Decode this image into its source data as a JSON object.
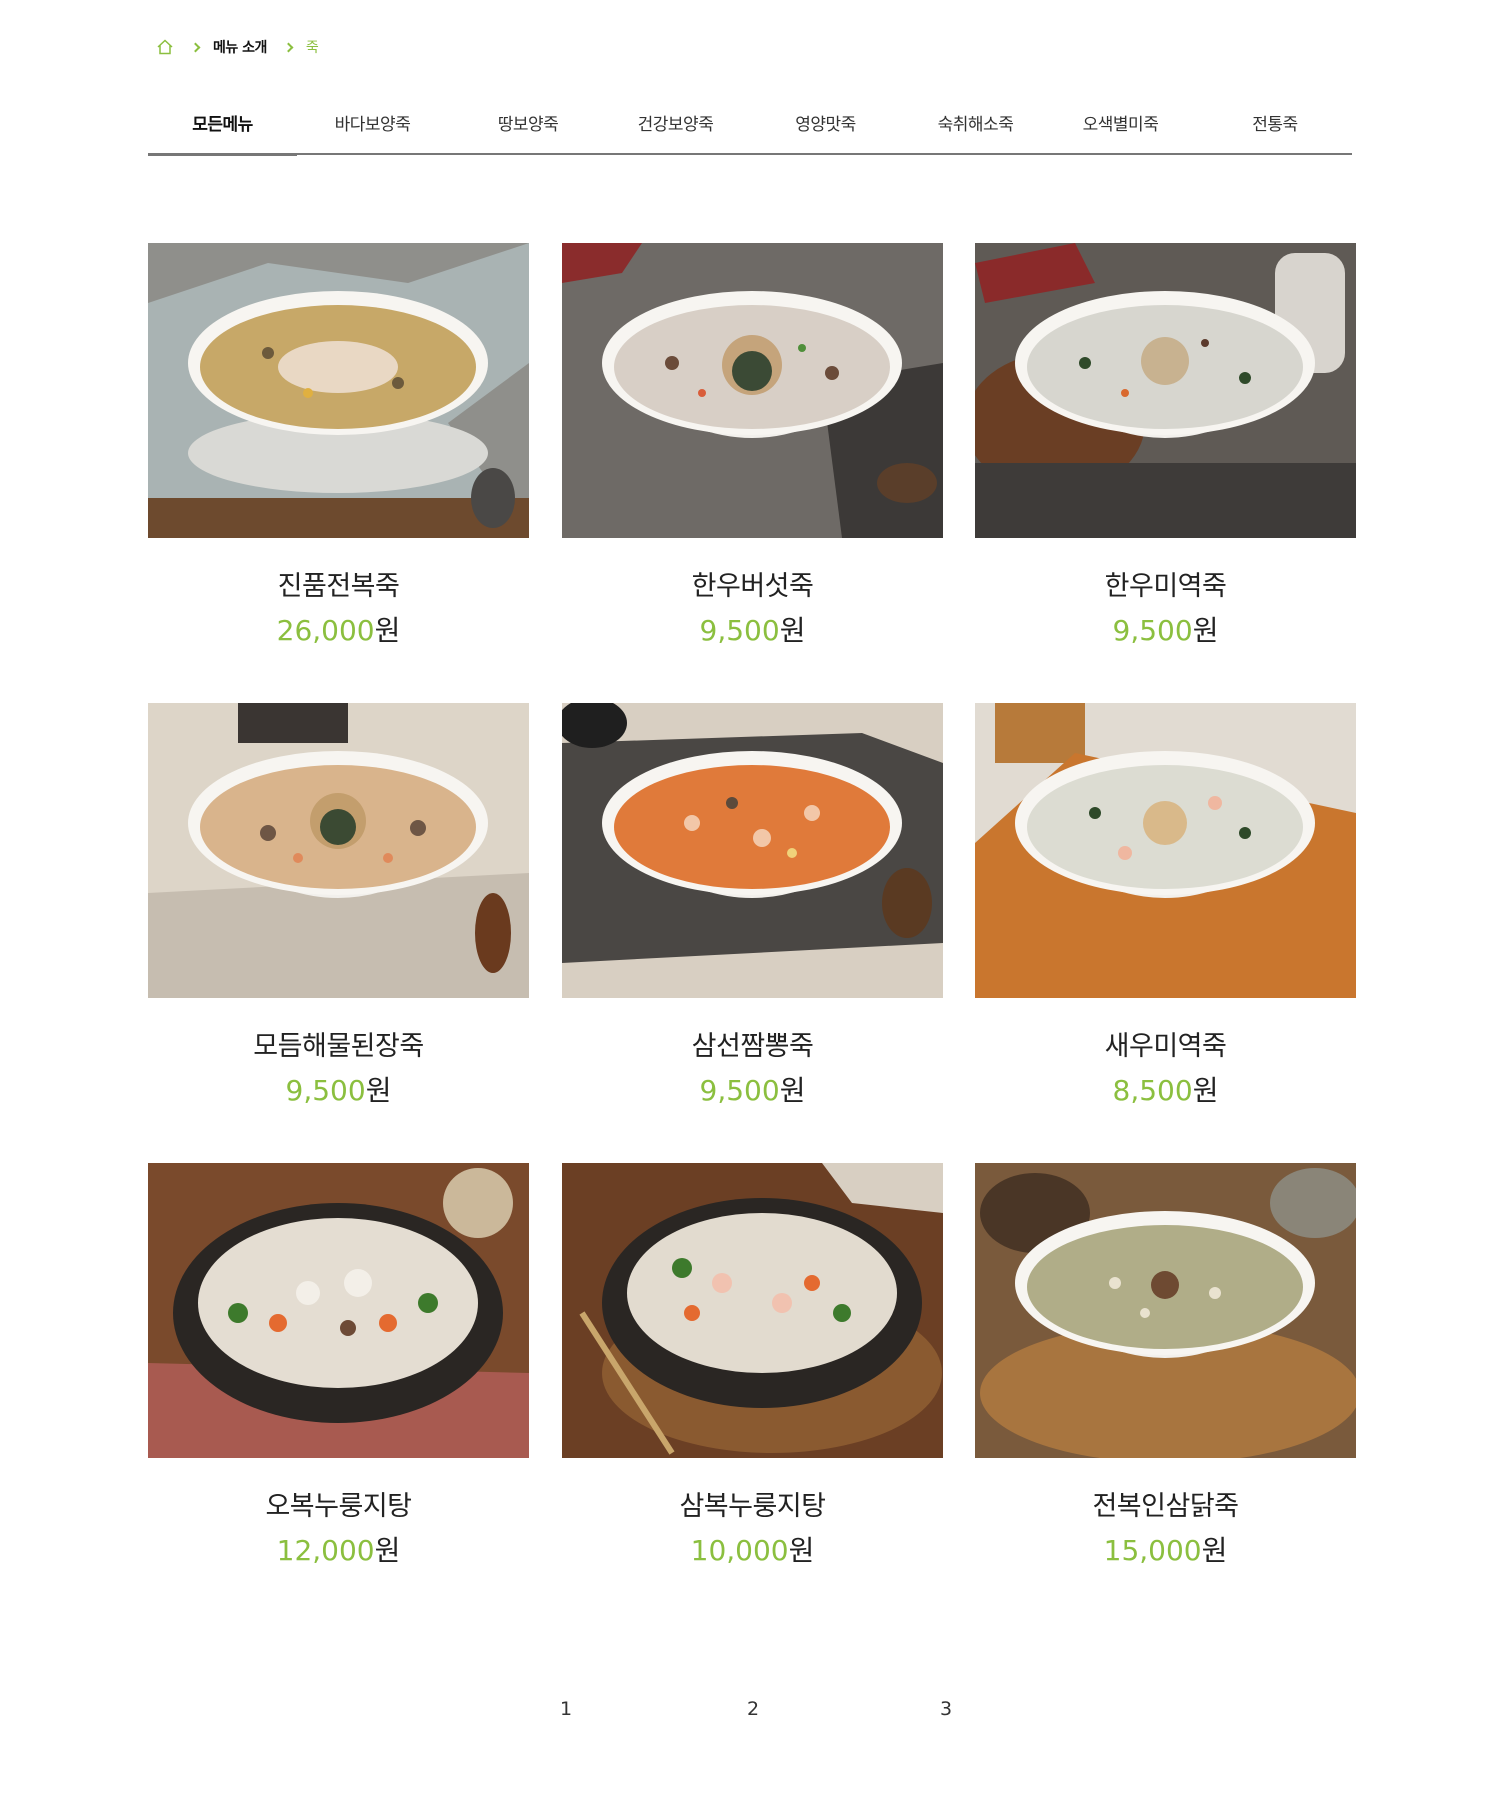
{
  "breadcrumb": {
    "home_icon": "home-icon",
    "items": [
      "메뉴 소개",
      "죽"
    ]
  },
  "tabs": [
    "모든메뉴",
    "바다보양죽",
    "땅보양죽",
    "건강보양죽",
    "영양맛죽",
    "숙취해소죽",
    "오색별미죽",
    "전통죽"
  ],
  "active_tab": "모든메뉴",
  "products": [
    {
      "name": "진품전복죽",
      "price": "26,000",
      "unit": "원"
    },
    {
      "name": "한우버섯죽",
      "price": "9,500",
      "unit": "원"
    },
    {
      "name": "한우미역죽",
      "price": "9,500",
      "unit": "원"
    },
    {
      "name": "모듬해물된장죽",
      "price": "9,500",
      "unit": "원"
    },
    {
      "name": "삼선짬뽕죽",
      "price": "9,500",
      "unit": "원"
    },
    {
      "name": "새우미역죽",
      "price": "8,500",
      "unit": "원"
    },
    {
      "name": "오복누룽지탕",
      "price": "12,000",
      "unit": "원"
    },
    {
      "name": "삼복누룽지탕",
      "price": "10,000",
      "unit": "원"
    },
    {
      "name": "전복인삼닭죽",
      "price": "15,000",
      "unit": "원"
    }
  ],
  "pagination": [
    "1",
    "2",
    "3"
  ],
  "colors": {
    "accent": "#8bbf3f",
    "text": "#222222",
    "divider": "#777777"
  }
}
